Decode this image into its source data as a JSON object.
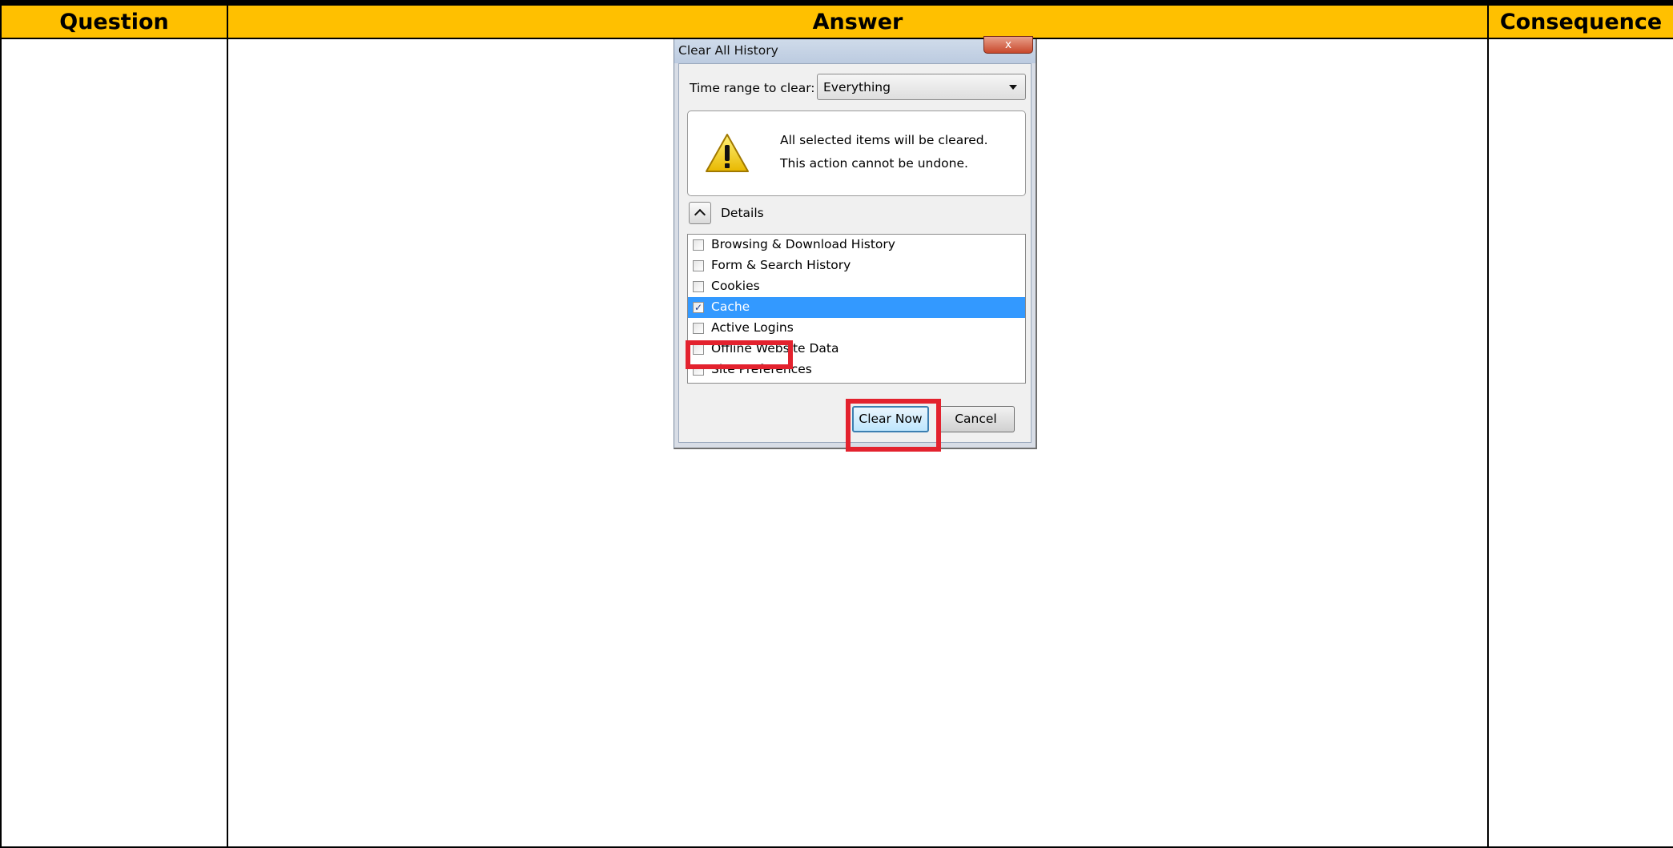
{
  "table": {
    "headers": [
      "Question",
      "Answer",
      "Consequence"
    ],
    "header_bg": "#ffc000"
  },
  "dialog": {
    "title": "Clear All History",
    "close_glyph": "x",
    "time_range_label": "Time range to clear:",
    "time_range_value": "Everything",
    "warning_line1": "All selected items will be cleared.",
    "warning_line2": "This action cannot be undone.",
    "warning_icon": "warning-triangle-icon",
    "details_label": "Details",
    "items": [
      {
        "label": "Browsing & Download History",
        "checked": false
      },
      {
        "label": "Form & Search History",
        "checked": false
      },
      {
        "label": "Cookies",
        "checked": false
      },
      {
        "label": "Cache",
        "checked": true
      },
      {
        "label": "Active Logins",
        "checked": false
      },
      {
        "label": "Offline Website Data",
        "checked": false
      },
      {
        "label": "Site Preferences",
        "checked": false
      }
    ],
    "selected_item": "Cache",
    "selection_color": "#3399ff",
    "clear_now_label": "Clear Now",
    "cancel_label": "Cancel",
    "highlight_color": "#e3222e"
  }
}
